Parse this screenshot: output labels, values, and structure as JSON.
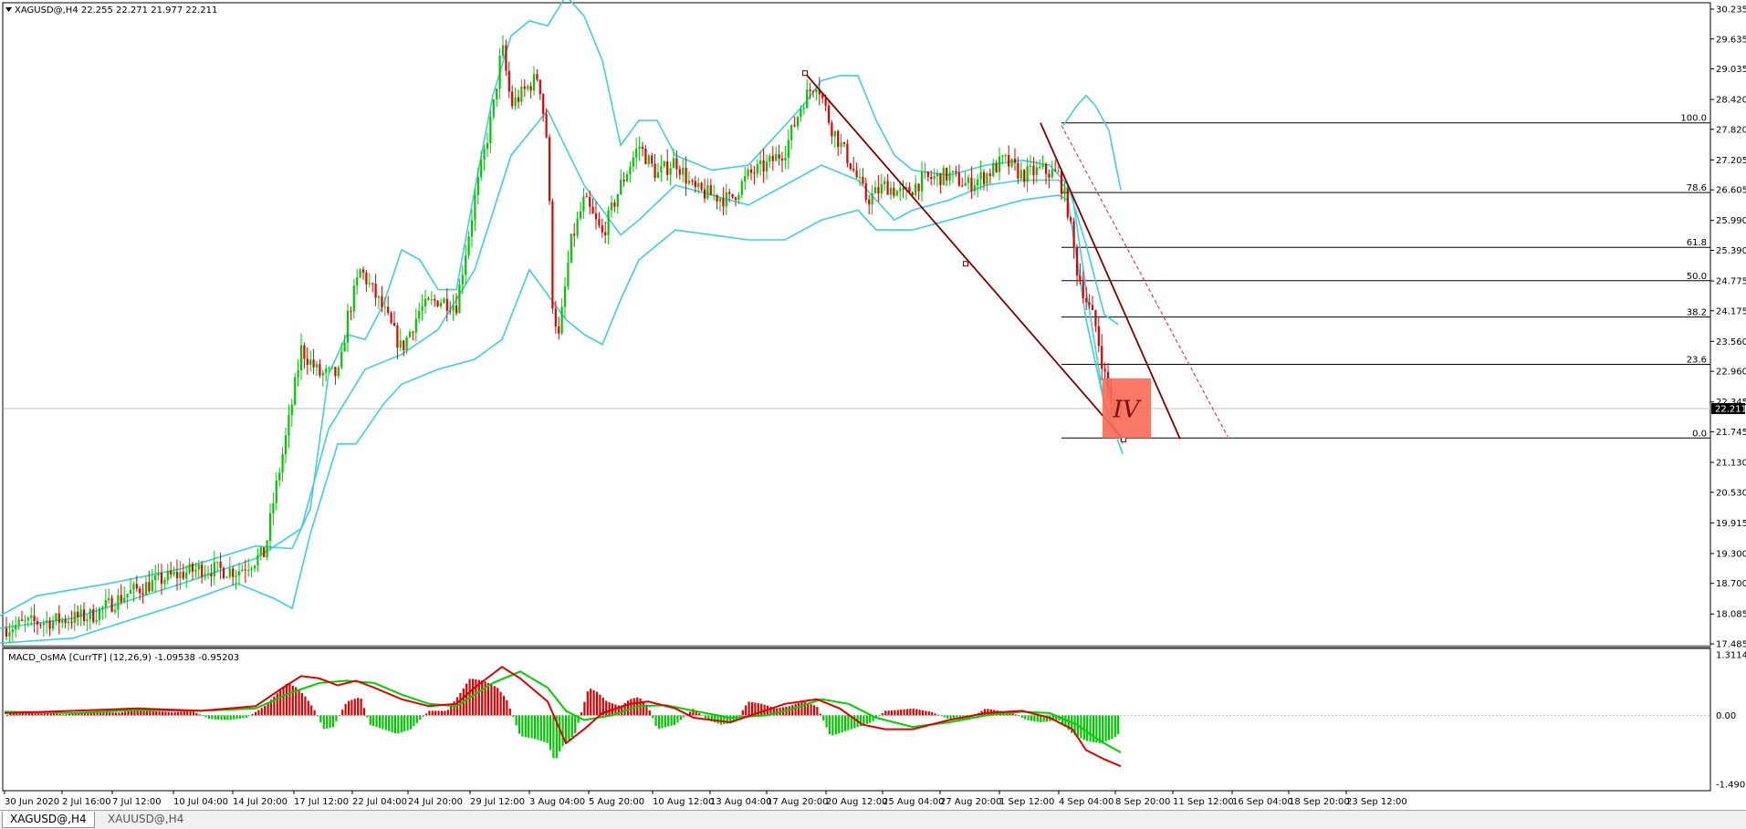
{
  "header": {
    "main_info": "XAGUSD@,H4  22.255 22.271 21.977 22.211",
    "indicator_info": "MACD_OsMA [CurrTF] (12,26,9) -1.09538 -0.95203"
  },
  "price_axis": {
    "labels": [
      "30.235",
      "29.635",
      "29.035",
      "28.420",
      "27.820",
      "27.205",
      "26.605",
      "25.990",
      "25.390",
      "24.775",
      "24.175",
      "23.560",
      "22.960",
      "22.345",
      "21.745",
      "21.130",
      "20.530",
      "19.915",
      "19.300",
      "18.700",
      "18.085",
      "17.485"
    ],
    "current_price": "22.211"
  },
  "indicator_axis": {
    "labels": [
      "1.3114",
      "0.00",
      "-1.4903"
    ]
  },
  "time_axis": {
    "labels": [
      "30 Jun 2020",
      "2 Jul 16:00",
      "7 Jul 12:00",
      "10 Jul 04:00",
      "14 Jul 20:00",
      "17 Jul 12:00",
      "22 Jul 04:00",
      "24 Jul 20:00",
      "29 Jul 12:00",
      "3 Aug 04:00",
      "5 Aug 20:00",
      "10 Aug 12:00",
      "13 Aug 04:00",
      "17 Aug 20:00",
      "20 Aug 12:00",
      "25 Aug 04:00",
      "27 Aug 20:00",
      "1 Sep 12:00",
      "4 Sep 04:00",
      "8 Sep 20:00",
      "11 Sep 12:00",
      "16 Sep 04:00",
      "18 Sep 20:00",
      "23 Sep 12:00"
    ]
  },
  "fibonacci": {
    "levels": [
      {
        "label": "100.0",
        "price": 27.95
      },
      {
        "label": "78.6",
        "price": 26.55
      },
      {
        "label": "61.8",
        "price": 25.45
      },
      {
        "label": "50.0",
        "price": 24.78
      },
      {
        "label": "38.2",
        "price": 24.05
      },
      {
        "label": "23.6",
        "price": 23.1
      },
      {
        "label": "0.0",
        "price": 21.62
      }
    ]
  },
  "annotation": {
    "text": "IV",
    "color": "#fa6a55"
  },
  "tabs": [
    {
      "label": "XAGUSD@,H4",
      "active": true
    },
    {
      "label": "XAUUSD@,H4",
      "active": false
    }
  ],
  "colors": {
    "bull": "#00c800",
    "bear": "#e00000",
    "bands": "#40d0d8",
    "trendline": "#800000",
    "macd_main": "#e00000",
    "macd_signal": "#00d000"
  },
  "chart_data": {
    "type": "candlestick",
    "symbol": "XAGUSD@",
    "timeframe": "H4",
    "ylim": [
      17.48,
      30.4
    ],
    "bands": {
      "upper": [
        [
          0,
          18.05
        ],
        [
          40,
          18.45
        ],
        [
          120,
          18.7
        ],
        [
          200,
          19.0
        ],
        [
          280,
          19.45
        ],
        [
          320,
          19.4
        ],
        [
          340,
          20.2
        ],
        [
          360,
          22.9
        ],
        [
          380,
          23.7
        ],
        [
          400,
          23.6
        ],
        [
          420,
          24.3
        ],
        [
          440,
          25.4
        ],
        [
          460,
          25.2
        ],
        [
          480,
          24.6
        ],
        [
          500,
          24.6
        ],
        [
          520,
          26.6
        ],
        [
          540,
          28.5
        ],
        [
          560,
          29.7
        ],
        [
          580,
          30.0
        ],
        [
          600,
          29.9
        ],
        [
          620,
          30.5
        ],
        [
          640,
          30.1
        ],
        [
          660,
          29.2
        ],
        [
          680,
          27.5
        ],
        [
          700,
          28.0
        ],
        [
          720,
          28.0
        ],
        [
          740,
          27.3
        ],
        [
          780,
          27.0
        ],
        [
          820,
          27.1
        ],
        [
          860,
          27.9
        ],
        [
          880,
          28.3
        ],
        [
          900,
          28.8
        ],
        [
          920,
          28.9
        ],
        [
          940,
          28.9
        ],
        [
          960,
          28.0
        ],
        [
          980,
          27.3
        ],
        [
          1000,
          27.0
        ],
        [
          1040,
          26.9
        ],
        [
          1080,
          27.1
        ],
        [
          1120,
          27.2
        ],
        [
          1150,
          27.1
        ],
        [
          1170,
          26.7
        ],
        [
          1190,
          25.5
        ],
        [
          1210,
          24.1
        ],
        [
          1225,
          23.9
        ]
      ],
      "middle": [
        [
          0,
          17.8
        ],
        [
          80,
          18.0
        ],
        [
          200,
          18.7
        ],
        [
          280,
          19.2
        ],
        [
          330,
          19.8
        ],
        [
          360,
          21.8
        ],
        [
          400,
          23.0
        ],
        [
          440,
          23.3
        ],
        [
          480,
          23.8
        ],
        [
          520,
          25.0
        ],
        [
          560,
          27.3
        ],
        [
          600,
          28.2
        ],
        [
          640,
          26.7
        ],
        [
          680,
          25.7
        ],
        [
          700,
          26.0
        ],
        [
          740,
          26.7
        ],
        [
          780,
          26.5
        ],
        [
          820,
          26.3
        ],
        [
          860,
          26.7
        ],
        [
          900,
          27.1
        ],
        [
          940,
          26.8
        ],
        [
          980,
          26.0
        ],
        [
          1000,
          26.2
        ],
        [
          1040,
          26.4
        ],
        [
          1080,
          26.7
        ],
        [
          1120,
          26.8
        ],
        [
          1160,
          26.8
        ],
        [
          1175,
          26.5
        ],
        [
          1190,
          24.6
        ],
        [
          1210,
          22.3
        ],
        [
          1230,
          21.5
        ]
      ],
      "lower": [
        [
          0,
          17.5
        ],
        [
          80,
          17.6
        ],
        [
          200,
          18.3
        ],
        [
          260,
          18.7
        ],
        [
          300,
          18.4
        ],
        [
          320,
          18.2
        ],
        [
          340,
          19.7
        ],
        [
          370,
          21.5
        ],
        [
          390,
          21.5
        ],
        [
          420,
          22.3
        ],
        [
          440,
          22.7
        ],
        [
          480,
          23.0
        ],
        [
          520,
          23.2
        ],
        [
          550,
          23.6
        ],
        [
          580,
          25.0
        ],
        [
          620,
          24.0
        ],
        [
          640,
          23.7
        ],
        [
          660,
          23.5
        ],
        [
          680,
          24.4
        ],
        [
          700,
          25.2
        ],
        [
          740,
          25.8
        ],
        [
          780,
          25.7
        ],
        [
          820,
          25.6
        ],
        [
          860,
          25.6
        ],
        [
          900,
          26.0
        ],
        [
          940,
          26.2
        ],
        [
          960,
          25.8
        ],
        [
          1000,
          25.8
        ],
        [
          1040,
          26.0
        ],
        [
          1080,
          26.2
        ],
        [
          1120,
          26.4
        ],
        [
          1160,
          26.5
        ],
        [
          1170,
          26.4
        ],
        [
          1190,
          24.0
        ],
        [
          1210,
          22.3
        ],
        [
          1230,
          21.3
        ]
      ],
      "spike_upper": [
        [
          1165,
          27.9
        ],
        [
          1180,
          28.3
        ],
        [
          1190,
          28.5
        ],
        [
          1200,
          28.3
        ],
        [
          1215,
          27.8
        ],
        [
          1228,
          26.6
        ]
      ]
    },
    "price_path": [
      [
        5,
        17.8
      ],
      [
        30,
        17.9
      ],
      [
        60,
        17.95
      ],
      [
        100,
        18.05
      ],
      [
        140,
        18.5
      ],
      [
        180,
        18.8
      ],
      [
        220,
        19.0
      ],
      [
        260,
        18.95
      ],
      [
        290,
        19.3
      ],
      [
        300,
        20.4
      ],
      [
        315,
        21.8
      ],
      [
        330,
        23.4
      ],
      [
        350,
        22.9
      ],
      [
        372,
        22.9
      ],
      [
        380,
        24.0
      ],
      [
        395,
        25.0
      ],
      [
        420,
        24.2
      ],
      [
        440,
        23.4
      ],
      [
        460,
        24.2
      ],
      [
        480,
        24.4
      ],
      [
        500,
        24.3
      ],
      [
        520,
        26.4
      ],
      [
        540,
        28.2
      ],
      [
        550,
        29.5
      ],
      [
        560,
        28.3
      ],
      [
        575,
        28.6
      ],
      [
        590,
        28.9
      ],
      [
        600,
        27.5
      ],
      [
        605,
        24.4
      ],
      [
        612,
        23.6
      ],
      [
        625,
        25.5
      ],
      [
        640,
        26.4
      ],
      [
        660,
        25.7
      ],
      [
        680,
        26.7
      ],
      [
        700,
        27.5
      ],
      [
        720,
        26.9
      ],
      [
        740,
        27.2
      ],
      [
        760,
        26.6
      ],
      [
        780,
        26.5
      ],
      [
        800,
        26.4
      ],
      [
        820,
        26.9
      ],
      [
        840,
        27.1
      ],
      [
        860,
        27.4
      ],
      [
        880,
        28.4
      ],
      [
        895,
        28.8
      ],
      [
        910,
        27.9
      ],
      [
        930,
        27.2
      ],
      [
        950,
        26.4
      ],
      [
        970,
        26.7
      ],
      [
        990,
        26.5
      ],
      [
        1010,
        26.8
      ],
      [
        1040,
        26.9
      ],
      [
        1060,
        26.7
      ],
      [
        1080,
        26.9
      ],
      [
        1100,
        27.2
      ],
      [
        1120,
        26.9
      ],
      [
        1140,
        27.0
      ],
      [
        1160,
        26.9
      ],
      [
        1170,
        26.2
      ],
      [
        1180,
        25.0
      ],
      [
        1190,
        24.4
      ],
      [
        1200,
        23.9
      ],
      [
        1210,
        22.9
      ],
      [
        1220,
        22.2
      ],
      [
        1230,
        22.21
      ]
    ],
    "trendlines": [
      {
        "from": [
          882,
          28.95
        ],
        "to": [
          1231,
          21.59
        ],
        "mid_point": [
          1058,
          25.12
        ]
      },
      {
        "from": [
          1140,
          27.95
        ],
        "to": [
          1293,
          21.6
        ]
      }
    ],
    "channel_dashed": {
      "from": [
        1163,
        27.9
      ],
      "to": [
        1345,
        21.65
      ]
    },
    "macd": {
      "ylim": [
        -1.49,
        1.31
      ],
      "histogram": [
        [
          10,
          0.04
        ],
        [
          30,
          0.08
        ],
        [
          50,
          0.07
        ],
        [
          70,
          0.02
        ],
        [
          90,
          0.05
        ],
        [
          110,
          0.07
        ],
        [
          130,
          0.06
        ],
        [
          150,
          0.12
        ],
        [
          170,
          0.09
        ],
        [
          190,
          0.07
        ],
        [
          210,
          0.1
        ],
        [
          230,
          -0.08
        ],
        [
          250,
          -0.1
        ],
        [
          270,
          -0.05
        ],
        [
          290,
          0.2
        ],
        [
          300,
          0.4
        ],
        [
          315,
          0.7
        ],
        [
          325,
          0.6
        ],
        [
          335,
          0.4
        ],
        [
          345,
          0.1
        ],
        [
          355,
          -0.3
        ],
        [
          365,
          -0.25
        ],
        [
          380,
          0.3
        ],
        [
          395,
          0.4
        ],
        [
          405,
          -0.2
        ],
        [
          420,
          -0.3
        ],
        [
          435,
          -0.4
        ],
        [
          450,
          -0.3
        ],
        [
          470,
          0.1
        ],
        [
          490,
          0.1
        ],
        [
          505,
          0.5
        ],
        [
          515,
          0.8
        ],
        [
          530,
          0.75
        ],
        [
          545,
          0.6
        ],
        [
          555,
          0.35
        ],
        [
          570,
          -0.45
        ],
        [
          585,
          -0.5
        ],
        [
          600,
          -0.6
        ],
        [
          608,
          -1.0
        ],
        [
          615,
          -0.7
        ],
        [
          630,
          -0.4
        ],
        [
          645,
          0.6
        ],
        [
          655,
          0.5
        ],
        [
          665,
          0.3
        ],
        [
          680,
          0.2
        ],
        [
          690,
          0.35
        ],
        [
          700,
          0.4
        ],
        [
          710,
          0.2
        ],
        [
          720,
          -0.3
        ],
        [
          740,
          -0.2
        ],
        [
          760,
          0.15
        ],
        [
          775,
          -0.1
        ],
        [
          790,
          -0.2
        ],
        [
          805,
          -0.15
        ],
        [
          820,
          0.3
        ],
        [
          835,
          0.25
        ],
        [
          850,
          0.15
        ],
        [
          865,
          0.2
        ],
        [
          880,
          0.3
        ],
        [
          895,
          0.2
        ],
        [
          910,
          -0.45
        ],
        [
          925,
          -0.35
        ],
        [
          940,
          -0.25
        ],
        [
          955,
          -0.15
        ],
        [
          970,
          0.1
        ],
        [
          985,
          0.12
        ],
        [
          1000,
          0.15
        ],
        [
          1020,
          0.08
        ],
        [
          1040,
          -0.08
        ],
        [
          1060,
          -0.1
        ],
        [
          1080,
          0.15
        ],
        [
          1095,
          0.1
        ],
        [
          1110,
          0.05
        ],
        [
          1125,
          -0.1
        ],
        [
          1140,
          -0.15
        ],
        [
          1160,
          -0.1
        ],
        [
          1175,
          -0.4
        ],
        [
          1190,
          -0.55
        ],
        [
          1205,
          -0.6
        ],
        [
          1220,
          -0.5
        ],
        [
          1228,
          -0.35
        ]
      ],
      "main_line": [
        [
          5,
          0.05
        ],
        [
          80,
          0.1
        ],
        [
          150,
          0.15
        ],
        [
          220,
          0.1
        ],
        [
          280,
          0.2
        ],
        [
          310,
          0.6
        ],
        [
          330,
          0.85
        ],
        [
          350,
          0.8
        ],
        [
          370,
          0.65
        ],
        [
          390,
          0.75
        ],
        [
          410,
          0.6
        ],
        [
          440,
          0.35
        ],
        [
          470,
          0.2
        ],
        [
          500,
          0.25
        ],
        [
          520,
          0.6
        ],
        [
          550,
          1.05
        ],
        [
          570,
          0.8
        ],
        [
          600,
          0.3
        ],
        [
          620,
          -0.6
        ],
        [
          640,
          -0.3
        ],
        [
          660,
          0.05
        ],
        [
          690,
          0.25
        ],
        [
          710,
          0.3
        ],
        [
          740,
          0.15
        ],
        [
          760,
          -0.05
        ],
        [
          800,
          -0.15
        ],
        [
          830,
          0.05
        ],
        [
          860,
          0.25
        ],
        [
          895,
          0.35
        ],
        [
          920,
          0.15
        ],
        [
          945,
          -0.2
        ],
        [
          970,
          -0.3
        ],
        [
          1000,
          -0.3
        ],
        [
          1040,
          -0.1
        ],
        [
          1080,
          0.05
        ],
        [
          1120,
          0.1
        ],
        [
          1150,
          -0.05
        ],
        [
          1175,
          -0.3
        ],
        [
          1190,
          -0.75
        ],
        [
          1210,
          -0.95
        ],
        [
          1228,
          -1.1
        ]
      ],
      "signal_line": [
        [
          5,
          0.08
        ],
        [
          80,
          0.05
        ],
        [
          150,
          0.12
        ],
        [
          220,
          0.1
        ],
        [
          280,
          0.15
        ],
        [
          320,
          0.5
        ],
        [
          350,
          0.7
        ],
        [
          380,
          0.75
        ],
        [
          410,
          0.7
        ],
        [
          440,
          0.45
        ],
        [
          470,
          0.25
        ],
        [
          500,
          0.2
        ],
        [
          540,
          0.7
        ],
        [
          570,
          0.95
        ],
        [
          600,
          0.6
        ],
        [
          620,
          0.1
        ],
        [
          640,
          -0.1
        ],
        [
          670,
          0.0
        ],
        [
          700,
          0.2
        ],
        [
          730,
          0.22
        ],
        [
          760,
          0.1
        ],
        [
          800,
          -0.05
        ],
        [
          840,
          0.0
        ],
        [
          870,
          0.15
        ],
        [
          900,
          0.35
        ],
        [
          930,
          0.25
        ],
        [
          960,
          -0.05
        ],
        [
          1000,
          -0.25
        ],
        [
          1040,
          -0.15
        ],
        [
          1080,
          0.0
        ],
        [
          1120,
          0.08
        ],
        [
          1150,
          0.05
        ],
        [
          1180,
          -0.2
        ],
        [
          1205,
          -0.55
        ],
        [
          1228,
          -0.8
        ]
      ]
    }
  }
}
